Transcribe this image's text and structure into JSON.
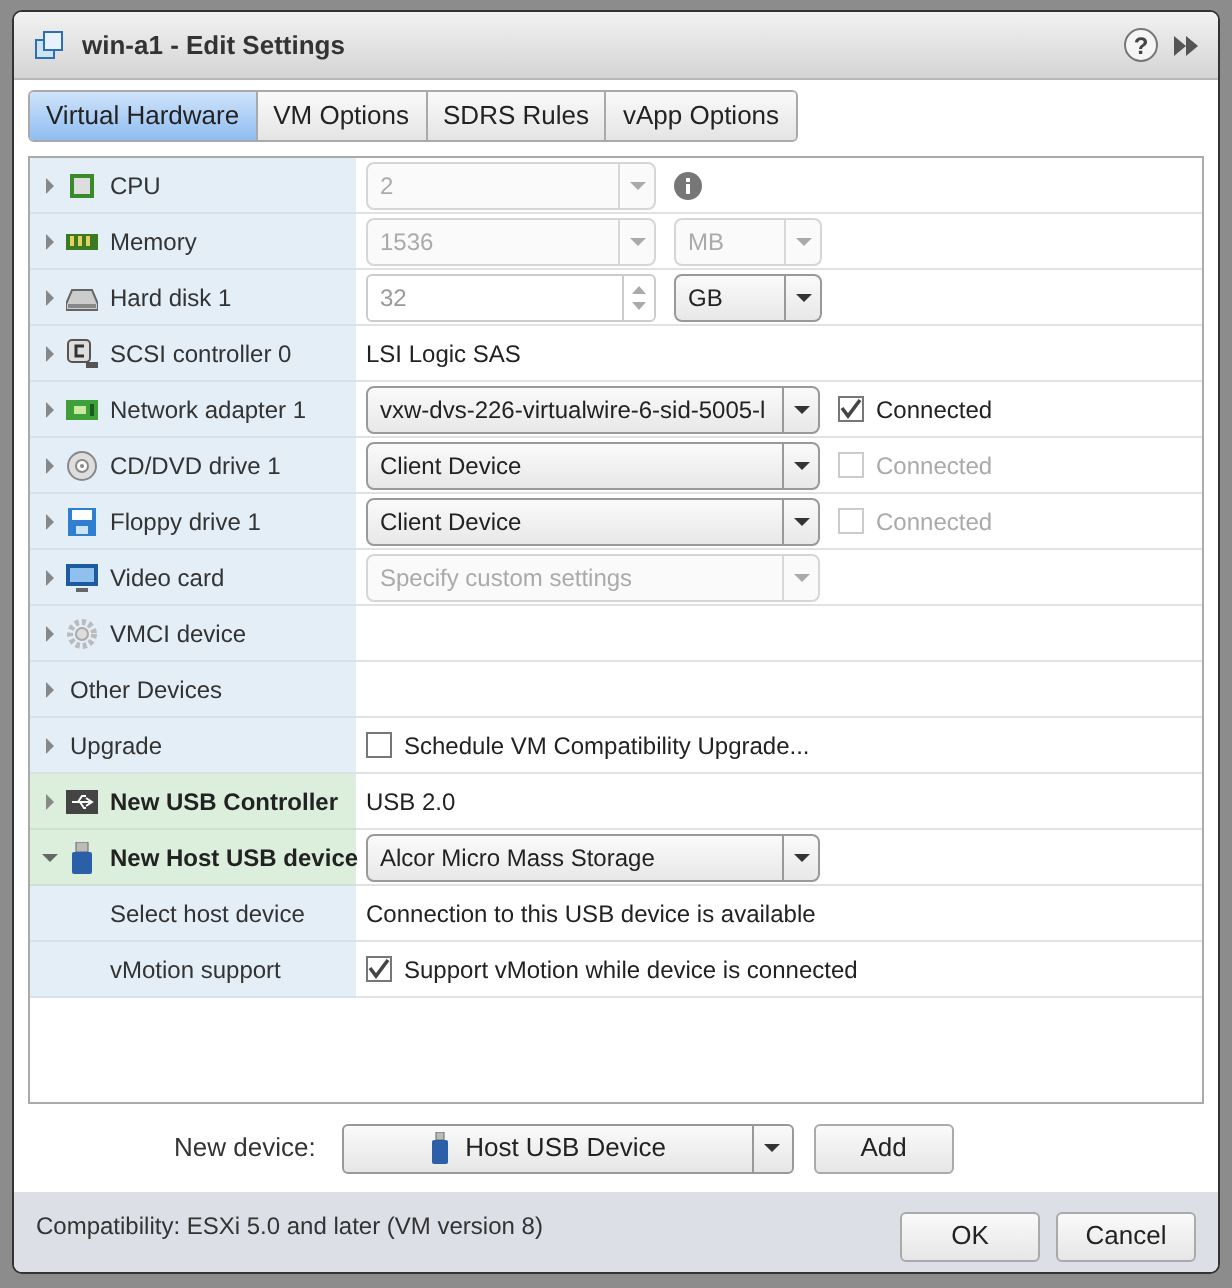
{
  "window": {
    "title": "win-a1 - Edit Settings",
    "help": "?"
  },
  "tabs": [
    {
      "label": "Virtual Hardware",
      "selected": true
    },
    {
      "label": "VM Options",
      "selected": false
    },
    {
      "label": "SDRS Rules",
      "selected": false
    },
    {
      "label": "vApp Options",
      "selected": false
    }
  ],
  "rows": [
    {
      "label": "CPU",
      "kind": "cpu",
      "is_new": false,
      "expanded": false,
      "value": {
        "kind": "combo",
        "text": "2",
        "disabled": true
      },
      "extra": {
        "kind": "info"
      }
    },
    {
      "label": "Memory",
      "kind": "memory",
      "is_new": false,
      "expanded": false,
      "value": {
        "kind": "combo",
        "text": "1536",
        "disabled": true
      },
      "extra": {
        "kind": "unit",
        "text": "MB",
        "disabled": true
      }
    },
    {
      "label": "Hard disk 1",
      "kind": "disk",
      "is_new": false,
      "expanded": false,
      "value": {
        "kind": "spinner",
        "text": "32"
      },
      "extra": {
        "kind": "unit",
        "text": "GB",
        "disabled": false
      }
    },
    {
      "label": "SCSI controller 0",
      "kind": "scsi",
      "is_new": false,
      "expanded": false,
      "value": {
        "kind": "text",
        "text": "LSI Logic SAS"
      }
    },
    {
      "label": "Network adapter 1",
      "kind": "nic",
      "is_new": false,
      "expanded": false,
      "value": {
        "kind": "combo",
        "text": "vxw-dvs-226-virtualwire-6-sid-5005-l",
        "disabled": false
      },
      "extra": {
        "kind": "checkbox",
        "label": "Connected",
        "checked": true,
        "disabled": false
      }
    },
    {
      "label": "CD/DVD drive 1",
      "kind": "cdrom",
      "is_new": false,
      "expanded": false,
      "value": {
        "kind": "combo",
        "text": "Client Device",
        "disabled": false
      },
      "extra": {
        "kind": "checkbox",
        "label": "Connected",
        "checked": false,
        "disabled": true
      }
    },
    {
      "label": "Floppy drive 1",
      "kind": "floppy",
      "is_new": false,
      "expanded": false,
      "value": {
        "kind": "combo",
        "text": "Client Device",
        "disabled": false
      },
      "extra": {
        "kind": "checkbox",
        "label": "Connected",
        "checked": false,
        "disabled": true
      }
    },
    {
      "label": "Video card",
      "kind": "monitor",
      "is_new": false,
      "expanded": false,
      "value": {
        "kind": "combo",
        "text": "Specify custom settings",
        "disabled": true
      }
    },
    {
      "label": "VMCI device",
      "kind": "vmci",
      "is_new": false,
      "expanded": false
    },
    {
      "label": "Other Devices",
      "is_new": false,
      "expanded": false
    },
    {
      "label": "Upgrade",
      "is_new": false,
      "expanded": false,
      "value": {
        "kind": "checkbox",
        "label": "Schedule VM Compatibility Upgrade...",
        "checked": false,
        "disabled": false
      }
    },
    {
      "label": "New USB Controller",
      "kind": "usb",
      "is_new": true,
      "expanded": false,
      "value": {
        "kind": "text",
        "text": "USB 2.0"
      }
    },
    {
      "label": "New Host USB device",
      "kind": "usbstick",
      "is_new": true,
      "expanded": true,
      "value": {
        "kind": "combo",
        "text": "Alcor Micro Mass Storage",
        "disabled": false
      },
      "children": [
        {
          "label": "Select host device",
          "value": {
            "kind": "text",
            "text": "Connection to this USB device is available"
          }
        },
        {
          "label": "vMotion support",
          "value": {
            "kind": "checkbox",
            "label": "Support vMotion while device is connected",
            "checked": true,
            "disabled": false
          }
        }
      ]
    }
  ],
  "new_device": {
    "label": "New device:",
    "value": "Host USB Device",
    "add": "Add"
  },
  "footer": {
    "compatibility": "Compatibility: ESXi 5.0 and later (VM version 8)",
    "buttons": [
      "OK",
      "Cancel"
    ]
  }
}
